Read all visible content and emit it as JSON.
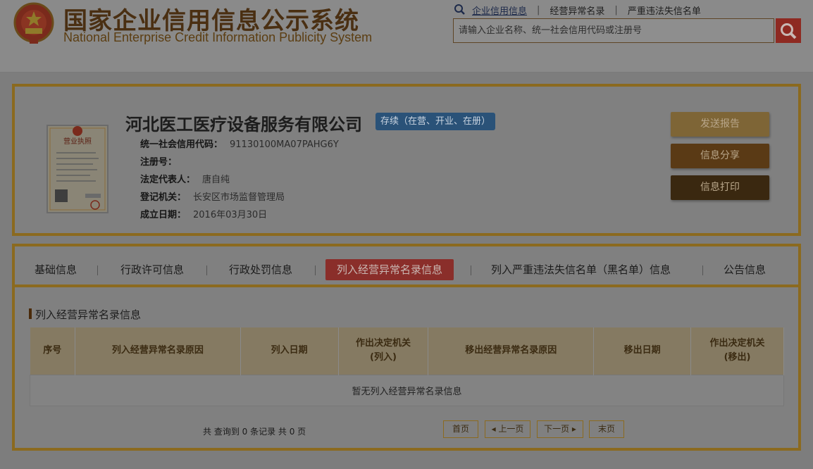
{
  "header": {
    "title_cn": "国家企业信用信息公示系统",
    "title_en": "National Enterprise Credit Information Publicity System",
    "links": [
      "企业信用信息",
      "经营异常名录",
      "严重违法失信名单"
    ],
    "search_placeholder": "请输入企业名称、统一社会信用代码或注册号"
  },
  "company": {
    "name": "河北医工医疗设备服务有限公司",
    "status": "存续（在营、开业、在册）",
    "fields": [
      {
        "key": "统一社会信用代码：",
        "value": "91130100MA07PAHG6Y"
      },
      {
        "key": "注册号：",
        "value": ""
      },
      {
        "key": "法定代表人：",
        "value": "唐自纯"
      },
      {
        "key": "登记机关：",
        "value": "长安区市场监督管理局"
      },
      {
        "key": "成立日期：",
        "value": "2016年03月30日"
      }
    ],
    "license_label": "营业执照",
    "actions": [
      "发送报告",
      "信息分享",
      "信息打印"
    ]
  },
  "tabs": [
    "基础信息",
    "行政许可信息",
    "行政处罚信息",
    "列入经营异常名录信息",
    "列入严重违法失信名单（黑名单）信息",
    "公告信息"
  ],
  "section": {
    "title": "列入经营异常名录信息",
    "columns": [
      "序号",
      "列入经营异常名录原因",
      "列入日期",
      "作出决定机关\n(列入)",
      "移出经营异常名录原因",
      "移出日期",
      "作出决定机关\n(移出)"
    ],
    "empty_message": "暂无列入经营异常名录信息"
  },
  "pager": {
    "summary": "共 查询到 0 条记录 共 0 页",
    "first": "首页",
    "prev": "◂ 上一页",
    "next": "下一页 ▸",
    "last": "末页"
  },
  "colors": {
    "accent_gold": "#8b6a1f",
    "active_tab": "#8a2e2a",
    "status_blue": "#2a5278",
    "search_red": "#8e2a22"
  }
}
